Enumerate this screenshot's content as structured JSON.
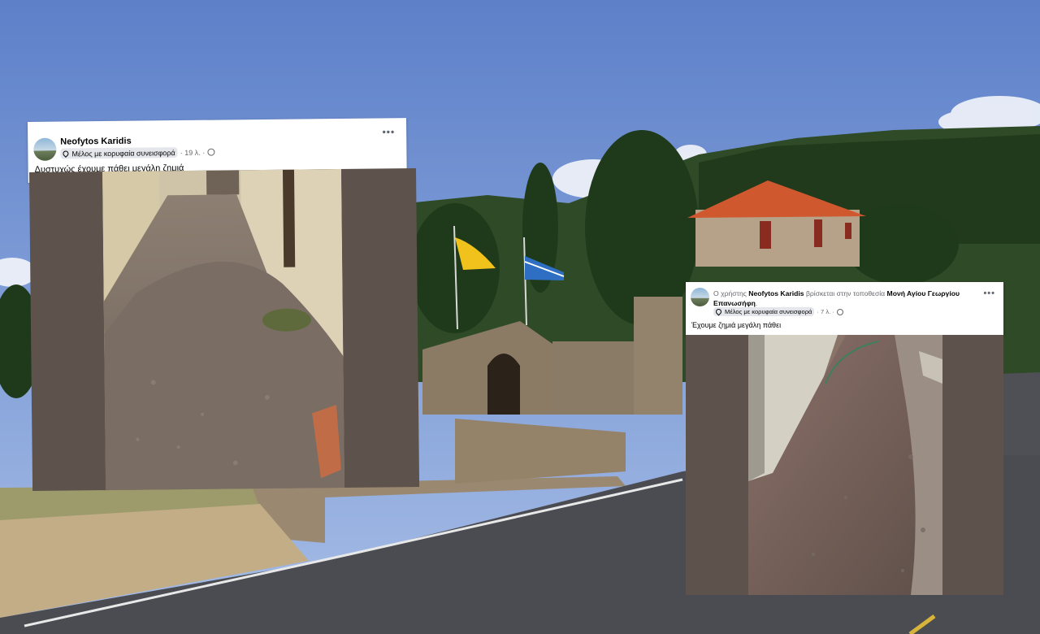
{
  "post1": {
    "author": "Neofytos Karidis",
    "badge": "Μέλος με κορυφαία συνεισφορά",
    "time": "· 19 λ. ·",
    "text": "Δυστυχώς έχουμε πάθει μεγάλη ζημιά",
    "more": "•••"
  },
  "post2": {
    "prefix": "Ο χρήστης",
    "author": "Neofytos Karidis",
    "location_prefix": "βρίσκεται στην τοποθεσία",
    "location": "Μονή Αγίου Γεωργίου Επανωσήφη",
    "dot": ".",
    "badge": "Μέλος με κορυφαία συνεισφορά",
    "time": "· 7 λ. ·",
    "text": "Έχουμε ζημιά μεγάλη πάθει",
    "more": "•••"
  },
  "colors": {
    "sky": "#7d9bd3",
    "road": "#4a4c52",
    "media_bg": "#5d524c",
    "roof": "#d0582f",
    "greek_flag_blue": "#2e6fc4",
    "byzantine_flag_yellow": "#f0c21b"
  },
  "icons": [
    "more-options-icon",
    "location-pin-icon",
    "globe-icon"
  ]
}
